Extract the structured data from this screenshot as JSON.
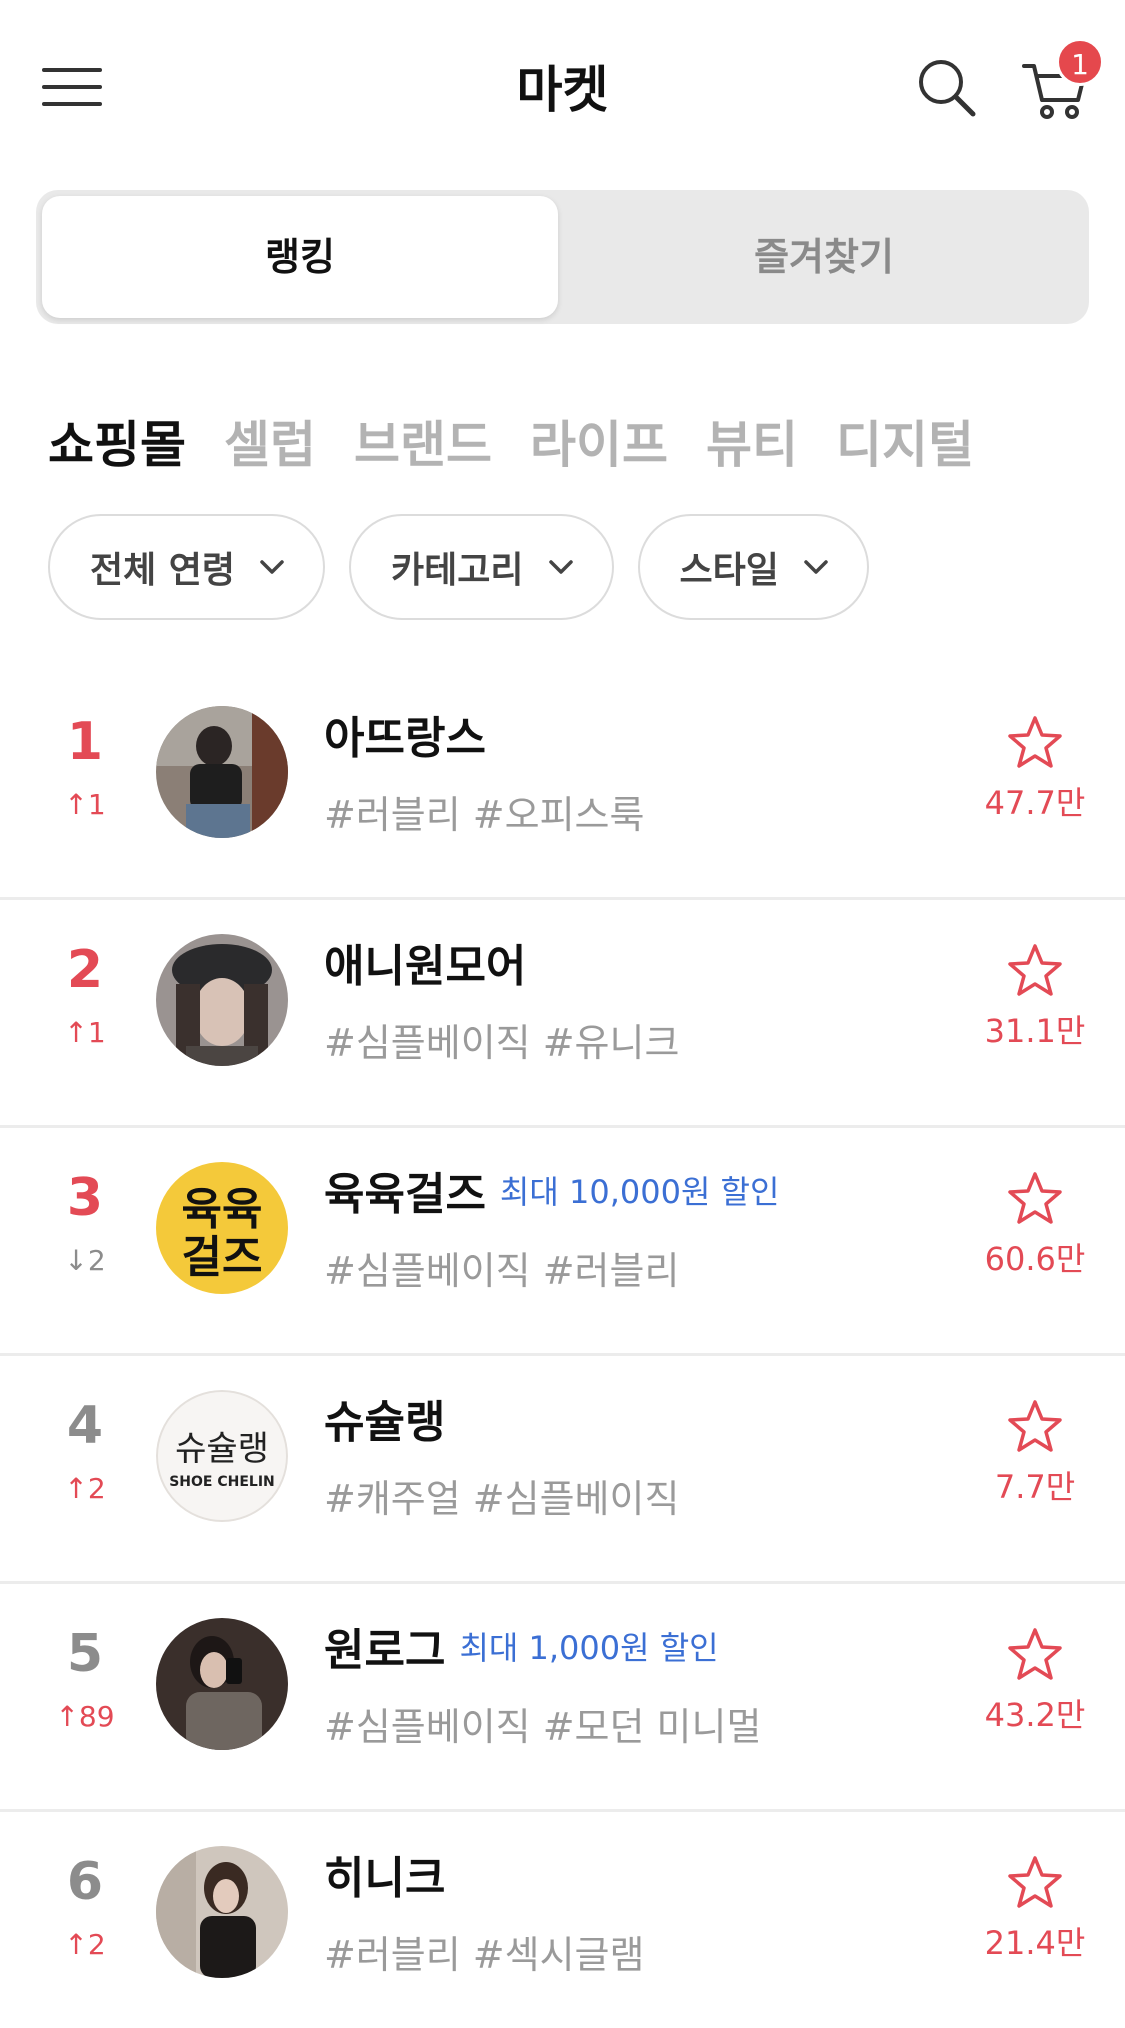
{
  "header": {
    "title": "마켓",
    "cart_count": "1",
    "icons": {
      "menu": "hamburger-icon",
      "search": "search-icon",
      "cart": "cart-icon"
    }
  },
  "segment": {
    "tabs": [
      "랭킹",
      "즐겨찾기"
    ],
    "active_index": 0
  },
  "categories": {
    "items": [
      "쇼핑몰",
      "셀럽",
      "브랜드",
      "라이프",
      "뷰티",
      "디지털"
    ],
    "active_index": 0
  },
  "filters": [
    {
      "label": "전체 연령"
    },
    {
      "label": "카테고리"
    },
    {
      "label": "스타일"
    }
  ],
  "colors": {
    "accent": "#e34a55",
    "promo": "#3b6fd4",
    "muted": "#9a9a9a"
  },
  "shops": [
    {
      "rank": "1",
      "change": "1",
      "change_dir": "up",
      "name": "아뜨랑스",
      "promo": "",
      "tags": "#러블리 #오피스룩",
      "fav": "47.7만",
      "avatar": "photo"
    },
    {
      "rank": "2",
      "change": "1",
      "change_dir": "up",
      "name": "애니원모어",
      "promo": "",
      "tags": "#심플베이직 #유니크",
      "fav": "31.1만",
      "avatar": "photo"
    },
    {
      "rank": "3",
      "change": "2",
      "change_dir": "down",
      "name": "육육걸즈",
      "promo": "최대 10,000원 할인",
      "tags": "#심플베이직 #러블리",
      "fav": "60.6만",
      "avatar": "logo-yellow",
      "logo_text": [
        "육육",
        "걸즈"
      ]
    },
    {
      "rank": "4",
      "change": "2",
      "change_dir": "up",
      "name": "슈슐랭",
      "promo": "",
      "tags": "#캐주얼 #심플베이직",
      "fav": "7.7만",
      "avatar": "logo-white",
      "logo_text": [
        "슈슐랭",
        "SHOE CHELIN"
      ]
    },
    {
      "rank": "5",
      "change": "89",
      "change_dir": "up",
      "name": "원로그",
      "promo": "최대 1,000원 할인",
      "tags": "#심플베이직 #모던 미니멀",
      "fav": "43.2만",
      "avatar": "photo"
    },
    {
      "rank": "6",
      "change": "2",
      "change_dir": "up",
      "name": "히니크",
      "promo": "",
      "tags": "#러블리 #섹시글램",
      "fav": "21.4만",
      "avatar": "photo"
    }
  ]
}
